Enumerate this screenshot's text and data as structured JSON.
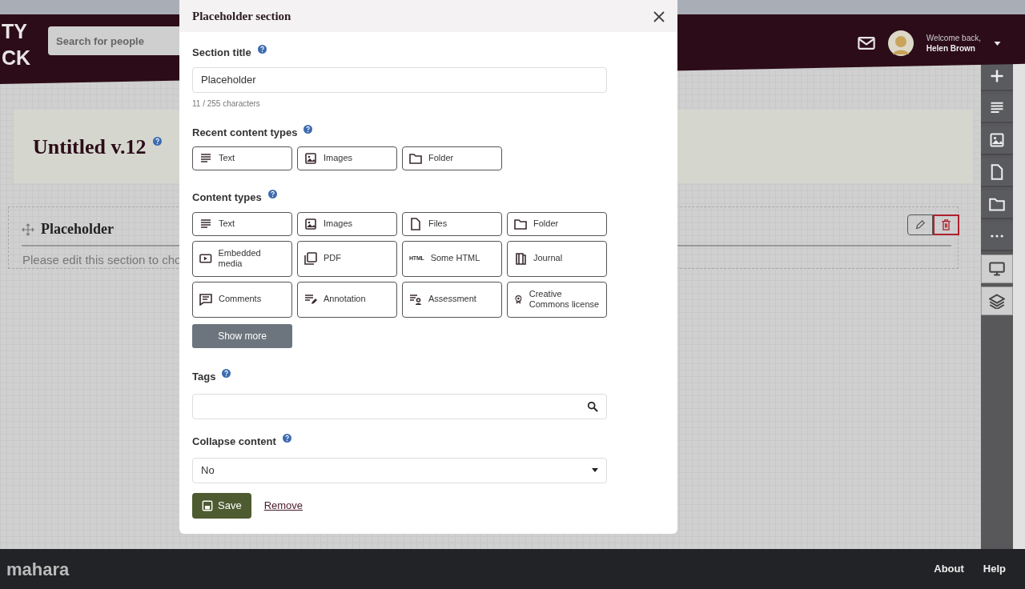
{
  "header": {
    "logo_lines": [
      "TY",
      "CK"
    ],
    "search": {
      "placeholder": "Search for people"
    },
    "user": {
      "greeting": "Welcome back,",
      "name": "Helen Brown"
    }
  },
  "page": {
    "title": "Untitled v.12",
    "section": {
      "title": "Placeholder",
      "text": "Please edit this section to cho"
    }
  },
  "toolbar": [
    {
      "kind": "plus"
    },
    {
      "kind": "text"
    },
    {
      "kind": "image"
    },
    {
      "kind": "file"
    },
    {
      "kind": "folder"
    },
    {
      "kind": "more"
    },
    {
      "kind": "monitor"
    },
    {
      "kind": "layers"
    }
  ],
  "modal": {
    "title": "Placeholder section",
    "section_title": {
      "label": "Section title",
      "value": "Placeholder",
      "hint": "11 / 255 characters"
    },
    "recent": {
      "label": "Recent content types",
      "items": [
        {
          "kind": "text",
          "label": "Text"
        },
        {
          "kind": "image",
          "label": "Images"
        },
        {
          "kind": "folder",
          "label": "Folder"
        }
      ]
    },
    "content_types": {
      "label": "Content types",
      "items": [
        {
          "kind": "text",
          "label": "Text"
        },
        {
          "kind": "image",
          "label": "Images"
        },
        {
          "kind": "file",
          "label": "Files"
        },
        {
          "kind": "folder",
          "label": "Folder"
        },
        {
          "kind": "media",
          "label": "Embedded media"
        },
        {
          "kind": "pdf",
          "label": "PDF"
        },
        {
          "kind": "html",
          "label": "Some HTML",
          "icon_text": "HTML"
        },
        {
          "kind": "journal",
          "label": "Journal"
        },
        {
          "kind": "comments",
          "label": "Comments"
        },
        {
          "kind": "annotation",
          "label": "Annotation"
        },
        {
          "kind": "assessment",
          "label": "Assessment"
        },
        {
          "kind": "license",
          "label": "Creative Commons license"
        }
      ],
      "show_more": "Show more"
    },
    "tags": {
      "label": "Tags"
    },
    "collapse": {
      "label": "Collapse content",
      "value": "No"
    },
    "save": "Save",
    "remove": "Remove"
  },
  "footer": {
    "logo": "mahara",
    "links": [
      "About",
      "Help"
    ]
  }
}
